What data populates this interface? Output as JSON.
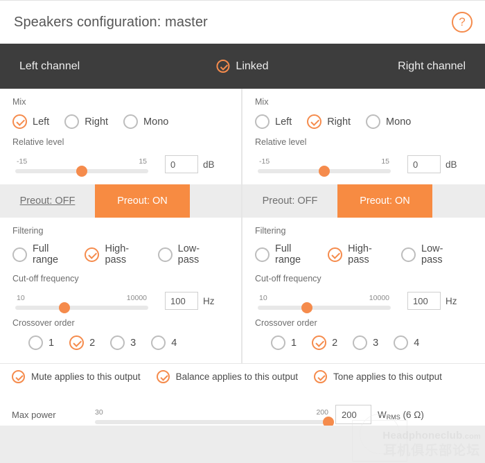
{
  "header": {
    "title": "Speakers configuration: master",
    "help_icon": "question-mark-circle-icon",
    "help_label": "?"
  },
  "channel_bar": {
    "left_label": "Left channel",
    "right_label": "Right channel",
    "linked_label": "Linked",
    "linked_checked": true,
    "background": "#3d3d3d"
  },
  "accent_color": "#f58b4c",
  "panels": [
    {
      "id": "left-channel",
      "mix": {
        "label": "Mix",
        "options": [
          "Left",
          "Right",
          "Mono"
        ],
        "selected": "Left"
      },
      "relative_level": {
        "label": "Relative level",
        "min_label": "-15",
        "max_label": "15",
        "value": "0",
        "unit": "dB",
        "thumb_pct": 50
      },
      "preout": {
        "off_label": "Preout: OFF",
        "on_label": "Preout: ON",
        "selected": "on",
        "off_hovered": true
      },
      "filtering": {
        "label": "Filtering",
        "options": [
          "Full range",
          "High-pass",
          "Low-pass"
        ],
        "selected": "High-pass"
      },
      "cutoff": {
        "label": "Cut-off frequency",
        "min_label": "10",
        "max_label": "10000",
        "value": "100",
        "unit": "Hz",
        "thumb_pct": 37
      },
      "crossover": {
        "label": "Crossover order",
        "options": [
          "1",
          "2",
          "3",
          "4"
        ],
        "selected": "2"
      }
    },
    {
      "id": "right-channel",
      "mix": {
        "label": "Mix",
        "options": [
          "Left",
          "Right",
          "Mono"
        ],
        "selected": "Right"
      },
      "relative_level": {
        "label": "Relative level",
        "min_label": "-15",
        "max_label": "15",
        "value": "0",
        "unit": "dB",
        "thumb_pct": 50
      },
      "preout": {
        "off_label": "Preout: OFF",
        "on_label": "Preout: ON",
        "selected": "on",
        "off_hovered": false
      },
      "filtering": {
        "label": "Filtering",
        "options": [
          "Full range",
          "High-pass",
          "Low-pass"
        ],
        "selected": "High-pass"
      },
      "cutoff": {
        "label": "Cut-off frequency",
        "min_label": "10",
        "max_label": "10000",
        "value": "100",
        "unit": "Hz",
        "thumb_pct": 37
      },
      "crossover": {
        "label": "Crossover order",
        "options": [
          "1",
          "2",
          "3",
          "4"
        ],
        "selected": "2"
      }
    }
  ],
  "output_options": [
    {
      "label": "Mute applies to this output",
      "checked": true
    },
    {
      "label": "Balance applies to this output",
      "checked": true
    },
    {
      "label": "Tone applies to this output",
      "checked": true
    }
  ],
  "max_power": {
    "label": "Max power",
    "min_label": "30",
    "max_label": "200",
    "value": "200",
    "unit_main": "W",
    "unit_sub": "RMS",
    "unit_tail": "(6 Ω)",
    "thumb_pct": 100
  },
  "watermark": {
    "line1_main": "Headphoneclub",
    "line1_domain": ".com",
    "line2": "耳机俱乐部论坛"
  }
}
